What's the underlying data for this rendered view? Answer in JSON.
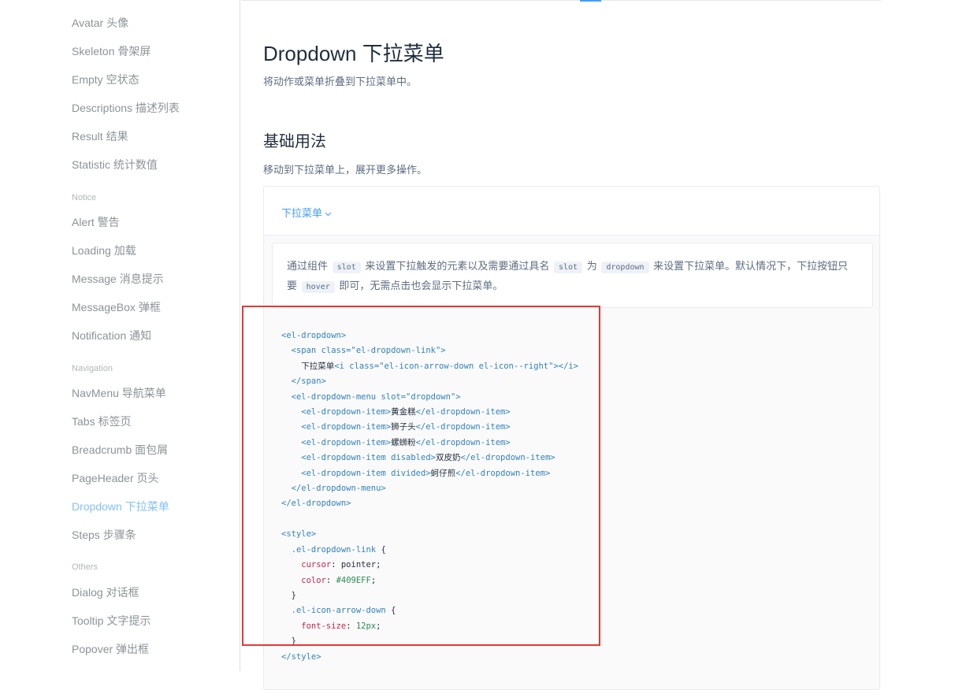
{
  "sidebar": {
    "items": [
      {
        "label": "Avatar 头像"
      },
      {
        "label": "Skeleton 骨架屏"
      },
      {
        "label": "Empty 空状态"
      },
      {
        "label": "Descriptions 描述列表"
      },
      {
        "label": "Result 结果"
      },
      {
        "label": "Statistic 统计数值"
      }
    ],
    "notice_group": "Notice",
    "notice_items": [
      {
        "label": "Alert 警告"
      },
      {
        "label": "Loading 加载"
      },
      {
        "label": "Message 消息提示"
      },
      {
        "label": "MessageBox 弹框"
      },
      {
        "label": "Notification 通知"
      }
    ],
    "navigation_group": "Navigation",
    "navigation_items": [
      {
        "label": "NavMenu 导航菜单"
      },
      {
        "label": "Tabs 标签页"
      },
      {
        "label": "Breadcrumb 面包屑"
      },
      {
        "label": "PageHeader 页头"
      },
      {
        "label": "Dropdown 下拉菜单"
      },
      {
        "label": "Steps 步骤条"
      }
    ],
    "others_group": "Others",
    "others_items": [
      {
        "label": "Dialog 对话框"
      },
      {
        "label": "Tooltip 文字提示"
      },
      {
        "label": "Popover 弹出框"
      }
    ]
  },
  "main": {
    "title": "Dropdown 下拉菜单",
    "description": "将动作或菜单折叠到下拉菜单中。",
    "section_title": "基础用法",
    "section_description": "移动到下拉菜单上，展开更多操作。",
    "demo_link": "下拉菜单",
    "demo_desc": {
      "part1": "通过组件",
      "code1": "slot",
      "part2": "来设置下拉触发的元素以及需要通过具名",
      "code2": "slot",
      "part3": "为",
      "code3": "dropdown",
      "part4": "来设置下拉菜单。默认情况下，下拉按钮只要",
      "code4": "hover",
      "part5": "即可，无需点击也会显示下拉菜单。"
    },
    "code": {
      "l1": "<el-dropdown>",
      "l2a": "  <span ",
      "l2b": "class=\"el-dropdown-link\"",
      "l2c": ">",
      "l3a": "    下拉菜单",
      "l3b": "<i ",
      "l3c": "class=\"el-icon-arrow-down el-icon--right\"",
      "l3d": "></i>",
      "l4": "  </span>",
      "l5a": "  <el-dropdown-menu ",
      "l5b": "slot=\"dropdown\"",
      "l5c": ">",
      "l6a": "    <el-dropdown-item>",
      "l6b": "黄金糕",
      "l6c": "</el-dropdown-item>",
      "l7a": "    <el-dropdown-item>",
      "l7b": "狮子头",
      "l7c": "</el-dropdown-item>",
      "l8a": "    <el-dropdown-item>",
      "l8b": "螺蛳粉",
      "l8c": "</el-dropdown-item>",
      "l9a": "    <el-dropdown-item ",
      "l9b": "disabled",
      "l9c": ">",
      "l9d": "双皮奶",
      "l9e": "</el-dropdown-item>",
      "l10a": "    <el-dropdown-item ",
      "l10b": "divided",
      "l10c": ">",
      "l10d": "蚵仔煎",
      "l10e": "</el-dropdown-item>",
      "l11": "  </el-dropdown-menu>",
      "l12": "</el-dropdown>",
      "l14": "<style>",
      "l15a": "  .el-dropdown-link ",
      "l15b": "{",
      "l16a": "    cursor",
      "l16b": ": pointer;",
      "l17a": "    color",
      "l17b": ": ",
      "l17c": "#409EFF",
      "l17d": ";",
      "l18": "  }",
      "l19a": "  .el-icon-arrow-down ",
      "l19b": "{",
      "l20a": "    font-size",
      "l20b": ": ",
      "l20c": "12px",
      "l20d": ";",
      "l21": "  }",
      "l22": "</style>"
    }
  },
  "colors": {
    "accent": "#409eff",
    "active_nav": "#82c1f8",
    "highlight_box": "#e53935"
  }
}
